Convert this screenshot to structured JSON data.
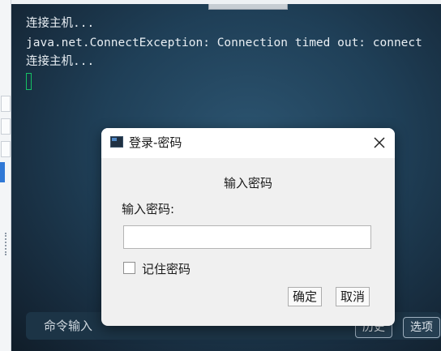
{
  "terminal": {
    "lines": [
      "连接主机...",
      "java.net.ConnectException: Connection timed out: connect",
      "连接主机..."
    ]
  },
  "command_bar": {
    "placeholder": "命令输入",
    "history_button": "历史",
    "options_button": "选项"
  },
  "dialog": {
    "title": "登录-密码",
    "heading": "输入密码",
    "password_label": "输入密码:",
    "password_value": "",
    "remember_label": "记住密码",
    "remember_checked": false,
    "ok_button": "确定",
    "cancel_button": "取消",
    "close_icon": "close-icon",
    "app_icon": "terminal-icon"
  },
  "colors": {
    "cursor": "#16c064",
    "terminal_bg": "#1f3f57"
  }
}
